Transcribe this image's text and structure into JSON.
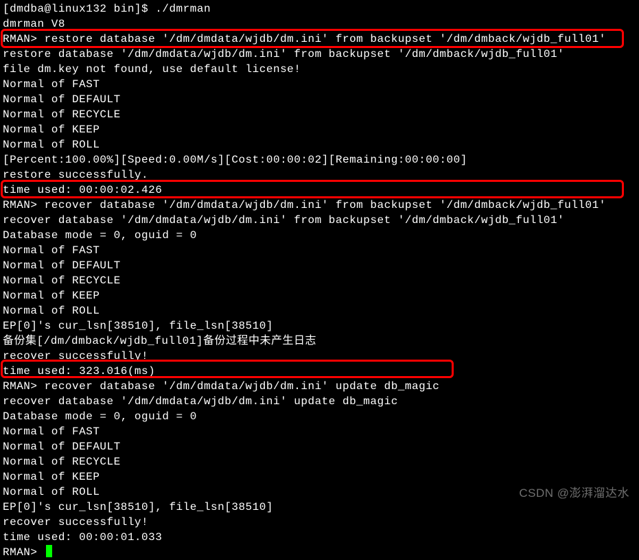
{
  "lines": {
    "l0": "[dmdba@linux132 bin]$ ./dmrman",
    "l1": "dmrman V8",
    "l2_prompt": "RMAN> ",
    "l2_cmd": "restore database '/dm/dmdata/wjdb/dm.ini' from backupset '/dm/dmback/wjdb_full01'",
    "l3": "restore database '/dm/dmdata/wjdb/dm.ini' from backupset '/dm/dmback/wjdb_full01'",
    "l4": "file dm.key not found, use default license!",
    "l5": "Normal of FAST",
    "l6": "Normal of DEFAULT",
    "l7": "Normal of RECYCLE",
    "l8": "Normal of KEEP",
    "l9": "Normal of ROLL",
    "l10": "[Percent:100.00%][Speed:0.00M/s][Cost:00:00:02][Remaining:00:00:00]",
    "l11": "restore successfully.",
    "l12": "time used: 00:00:02.426",
    "l13_prompt": "RMAN> ",
    "l13_cmd": "recover database '/dm/dmdata/wjdb/dm.ini' from backupset '/dm/dmback/wjdb_full01'",
    "l14": "recover database '/dm/dmdata/wjdb/dm.ini' from backupset '/dm/dmback/wjdb_full01'",
    "l15": "Database mode = 0, oguid = 0",
    "l16": "Normal of FAST",
    "l17": "Normal of DEFAULT",
    "l18": "Normal of RECYCLE",
    "l19": "Normal of KEEP",
    "l20": "Normal of ROLL",
    "l21": "EP[0]'s cur_lsn[38510], file_lsn[38510]",
    "l22": "备份集[/dm/dmback/wjdb_full01]备份过程中未产生日志",
    "l23": "recover successfully!",
    "l24": "time used: 323.016(ms)",
    "l25_prompt": "RMAN> ",
    "l25_cmd": "recover database '/dm/dmdata/wjdb/dm.ini' update db_magic",
    "l26": "recover database '/dm/dmdata/wjdb/dm.ini' update db_magic",
    "l27": "Database mode = 0, oguid = 0",
    "l28": "Normal of FAST",
    "l29": "Normal of DEFAULT",
    "l30": "Normal of RECYCLE",
    "l31": "Normal of KEEP",
    "l32": "Normal of ROLL",
    "l33": "EP[0]'s cur_lsn[38510], file_lsn[38510]",
    "l34": "recover successfully!",
    "l35": "time used: 00:00:01.033",
    "l36_prompt": "RMAN> "
  },
  "watermark": "CSDN @澎湃溜达水"
}
